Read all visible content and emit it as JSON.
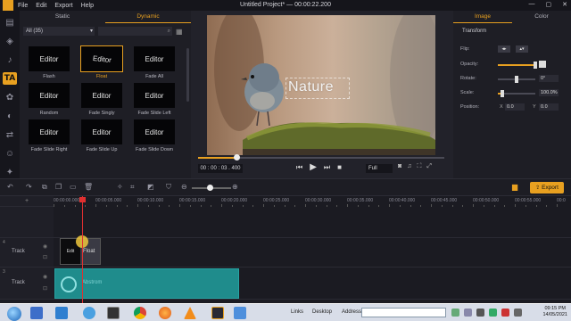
{
  "window": {
    "title": "Untitled Project* — 00:00:22.200",
    "menu": [
      "File",
      "Edit",
      "Export",
      "Help"
    ]
  },
  "tools": [
    "media-icon",
    "layers-icon",
    "audio-icon",
    "text-icon",
    "effects-icon",
    "filter-icon",
    "transition-icon",
    "sticker-icon",
    "element-icon"
  ],
  "effects": {
    "tabs": [
      "Static",
      "Dynamic"
    ],
    "active_tab": "Dynamic",
    "filter": "All (35)",
    "search_placeholder": "",
    "items": [
      {
        "thumb": "Editor",
        "label": "Flash"
      },
      {
        "thumb": "Editor",
        "label": "Float"
      },
      {
        "thumb": "Editor",
        "label": "Fade All"
      },
      {
        "thumb": "Editor",
        "label": "Random"
      },
      {
        "thumb": "Editor",
        "label": "Fade Singly"
      },
      {
        "thumb": "Editor",
        "label": "Fade Slide Left"
      },
      {
        "thumb": "Editor",
        "label": "Fade Slide Right"
      },
      {
        "thumb": "Editor",
        "label": "Fade Slide Up"
      },
      {
        "thumb": "Editor",
        "label": "Fade Slide Down"
      }
    ]
  },
  "preview": {
    "overlay_text": "Nature",
    "timecode": "00 : 00 : 03 . 400",
    "progress": 0.155,
    "quality": "Full"
  },
  "properties": {
    "tabs": [
      "Image",
      "Color"
    ],
    "active_tab": "Image",
    "section": "Transform",
    "flip_label": "Flip:",
    "opacity_label": "Opacity:",
    "opacity": 1.0,
    "rotate_label": "Rotate:",
    "rotate_value": "0°",
    "scale_label": "Scale:",
    "scale_value": "100.0%",
    "scale": 0.12,
    "position_label": "Position:",
    "x_label": "X",
    "x_value": "0.0",
    "y_label": "Y",
    "y_value": "0.0"
  },
  "toolbar": {
    "export_label": "Export"
  },
  "timeline": {
    "ticks": [
      "00:00:00.000",
      "00:00:05.000",
      "00:00:10.000",
      "00:00:15.000",
      "00:00:20.000",
      "00:00:25.000",
      "00:00:30.000",
      "00:00:35.000",
      "00:00:40.000",
      "00:00:45.000",
      "00:00:50.000",
      "00:00:55.000",
      "00:0"
    ],
    "tracks": [
      {
        "num": "4",
        "label": "Track"
      },
      {
        "num": "3",
        "label": "Track"
      }
    ],
    "text_clip": {
      "thumb": "Edit",
      "label": "Float"
    },
    "video_clip": {
      "label": "Abstrom"
    }
  },
  "taskbar": {
    "links_label": "Links",
    "desktop_label": "Desktop",
    "address_label": "Address",
    "time": "09:15 PM",
    "date": "14/05/2021"
  }
}
